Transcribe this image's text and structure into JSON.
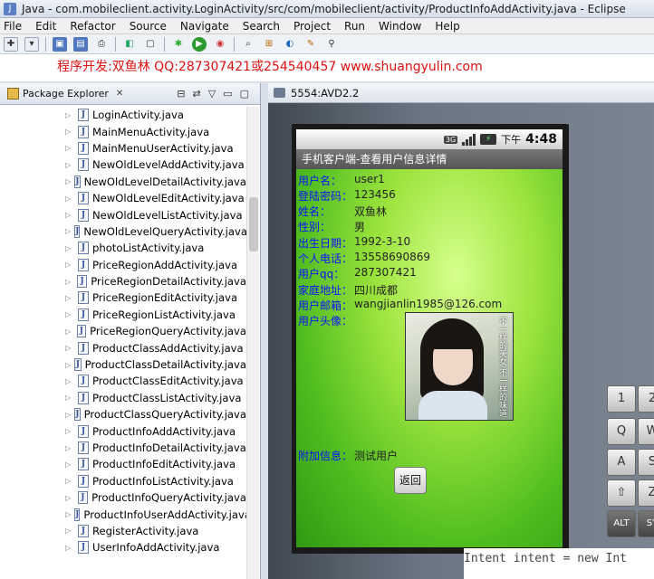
{
  "window": {
    "title": "Java - com.mobileclient.activity.LoginActivity/src/com/mobileclient/activity/ProductInfoAddActivity.java - Eclipse"
  },
  "menu": [
    "File",
    "Edit",
    "Refactor",
    "Source",
    "Navigate",
    "Search",
    "Project",
    "Run",
    "Window",
    "Help"
  ],
  "banner": "程序开发:双鱼林 QQ:287307421或254540457 www.shuangyulin.com",
  "package_explorer": {
    "title": "Package Explorer",
    "files": [
      "LoginActivity.java",
      "MainMenuActivity.java",
      "MainMenuUserActivity.java",
      "NewOldLevelAddActivity.java",
      "NewOldLevelDetailActivity.java",
      "NewOldLevelEditActivity.java",
      "NewOldLevelListActivity.java",
      "NewOldLevelQueryActivity.java",
      "photoListActivity.java",
      "PriceRegionAddActivity.java",
      "PriceRegionDetailActivity.java",
      "PriceRegionEditActivity.java",
      "PriceRegionListActivity.java",
      "PriceRegionQueryActivity.java",
      "ProductClassAddActivity.java",
      "ProductClassDetailActivity.java",
      "ProductClassEditActivity.java",
      "ProductClassListActivity.java",
      "ProductClassQueryActivity.java",
      "ProductInfoAddActivity.java",
      "ProductInfoDetailActivity.java",
      "ProductInfoEditActivity.java",
      "ProductInfoListActivity.java",
      "ProductInfoQueryActivity.java",
      "ProductInfoUserAddActivity.java",
      "RegisterActivity.java",
      "UserInfoAddActivity.java"
    ]
  },
  "emulator": {
    "title": "5554:AVD2.2",
    "status": {
      "network": "3G",
      "time_prefix": "下午",
      "time": "4:48"
    },
    "app_title": "手机客户端-查看用户信息详情",
    "fields": [
      {
        "label": "用户名：",
        "value": "user1"
      },
      {
        "label": "登陆密码：",
        "value": "123456"
      },
      {
        "label": "姓名：",
        "value": "双鱼林"
      },
      {
        "label": "性别：",
        "value": "男"
      },
      {
        "label": "出生日期：",
        "value": "1992-3-10"
      },
      {
        "label": "个人电话：",
        "value": "13558690869"
      },
      {
        "label": "用户qq：",
        "value": "287307421"
      },
      {
        "label": "家庭地址：",
        "value": "四川成都"
      },
      {
        "label": "用户邮箱：",
        "value": "wangjianlin1985@126.com"
      },
      {
        "label": "用户头像：",
        "value": ""
      }
    ],
    "avatar_caption": "不一样的美女 不一样的味道",
    "extra": {
      "label": "附加信息：",
      "value": "测试用户"
    },
    "back_button": "返回"
  },
  "keyboard": [
    "1",
    "2",
    "Q",
    "W",
    "A",
    "S",
    "⇧",
    "Z",
    "ALT",
    "SY"
  ],
  "code_peek": "Intent intent = new Int"
}
